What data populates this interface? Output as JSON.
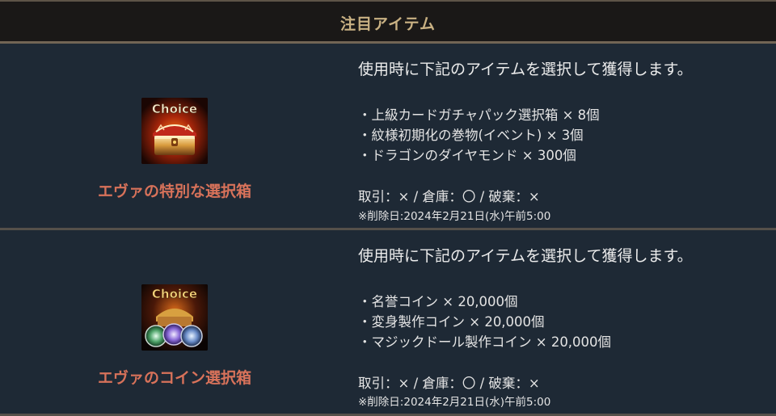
{
  "header": {
    "title": "注目アイテム"
  },
  "items": [
    {
      "name": "エヴァの特別な選択箱",
      "icon_label": "Choice",
      "icon": "treasure-chest-icon",
      "description": "使用時に下記のアイテムを選択して獲得します。",
      "contents": [
        "・上級カードガチャパック選択箱 × 8個",
        "・紋様初期化の巻物(イベント) × 3個",
        "・ドラゴンのダイヤモンド × 300個"
      ],
      "trade_info": "取引：× / 倉庫：〇 / 破棄：×",
      "delete_date": "※削除日:2024年2月21日(水)午前5:00"
    },
    {
      "name": "エヴァのコイン選択箱",
      "icon_label": "Choice",
      "icon": "coin-chest-icon",
      "description": "使用時に下記のアイテムを選択して獲得します。",
      "contents": [
        "・名誉コイン × 20,000個",
        "・変身製作コイン × 20,000個",
        "・マジックドール製作コイン × 20,000個"
      ],
      "trade_info": "取引：× / 倉庫：〇 / 破棄：×",
      "delete_date": "※削除日:2024年2月21日(水)午前5:00"
    }
  ],
  "colors": {
    "background": "#1e2935",
    "header_text": "#c9b183",
    "item_name": "#d8725a",
    "body_text": "#e4e4e4"
  }
}
